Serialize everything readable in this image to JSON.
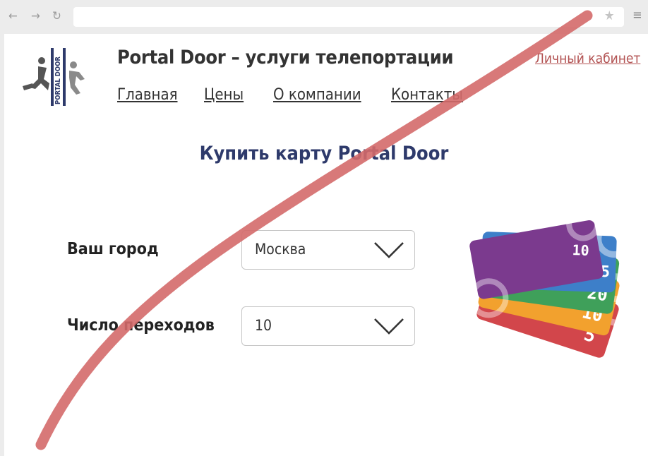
{
  "browser": {
    "back_icon": "arrow-left-icon",
    "forward_icon": "arrow-right-icon",
    "reload_icon": "reload-icon",
    "address_value": "",
    "star_icon": "star-icon",
    "menu_icon": "hamburger-menu-icon"
  },
  "header": {
    "logo_text": "PORTAL DOOR",
    "title": "Portal Door – услуги телепортации",
    "account_link": "Личный кабинет"
  },
  "nav": {
    "items": [
      {
        "label": "Главная"
      },
      {
        "label": "Цены"
      },
      {
        "label": "О компании"
      },
      {
        "label": "Контакты"
      }
    ]
  },
  "main": {
    "heading": "Купить карту Portal Door",
    "city": {
      "label": "Ваш город",
      "value": "Москва"
    },
    "transitions": {
      "label": "Число переходов",
      "value": "10"
    },
    "cards": {
      "values": [
        "10",
        "5",
        "20",
        "10",
        "5"
      ],
      "colors": [
        "#7b3a8e",
        "#3d7fc9",
        "#3fa05a",
        "#f2a12e",
        "#d2464b"
      ]
    }
  },
  "overlay": {
    "strike_color": "#d46a6a"
  }
}
